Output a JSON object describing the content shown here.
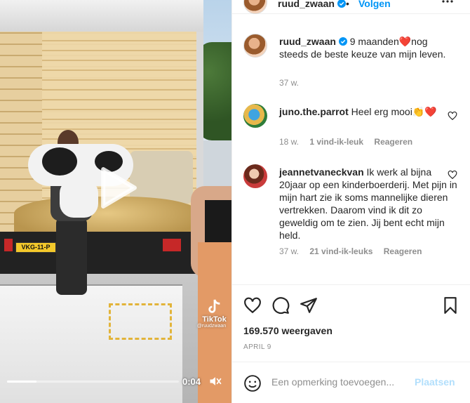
{
  "header": {
    "username": "ruud_zwaan",
    "separator": "•",
    "follow_label": "Volgen"
  },
  "video": {
    "time": "0:04",
    "progress_fraction": 0.17,
    "watermark": {
      "brand": "TikTok",
      "user": "@ruudzwaan"
    },
    "plate": "VKG-11-P"
  },
  "caption": {
    "username": "ruud_zwaan",
    "text": "9 maanden❤️nog steeds de beste keuze van mijn leven.",
    "age": "37 w."
  },
  "comments": [
    {
      "username": "juno.the.parrot",
      "text": "Heel erg mooi👏❤️",
      "age": "18 w.",
      "likes": "1 vind-ik-leuk",
      "reply_label": "Reageren"
    },
    {
      "username": "jeannetvaneckvan",
      "text": "Ik werk al bijna 20jaar op een kinderboerderij. Met pijn in mijn hart zie ik soms mannelijke dieren vertrekken. Daarom vind ik dit zo geweldig om te zien. Jij bent echt mijn held.",
      "age": "37 w.",
      "likes": "21 vind-ik-leuks",
      "reply_label": "Reageren"
    }
  ],
  "stats": {
    "views": "169.570 weergaven",
    "date": "APRIL 9"
  },
  "composer": {
    "placeholder": "Een opmerking toevoegen...",
    "post_label": "Plaatsen"
  },
  "colors": {
    "link_blue": "#0095f6",
    "post_disabled": "#b2dffc",
    "meta_gray": "#8e8e8e",
    "heart_red": "#ed4956"
  },
  "icons": [
    "play-icon",
    "mute-icon",
    "tiktok-logo-icon",
    "verified-icon",
    "more-options-icon",
    "heart-icon",
    "comment-icon",
    "share-icon",
    "bookmark-icon",
    "emoji-icon"
  ]
}
